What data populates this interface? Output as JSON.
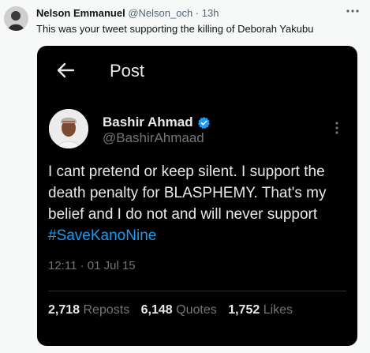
{
  "tweet": {
    "author_name": "Nelson Emmanuel",
    "author_handle": "@Nelson_och",
    "separator": " · ",
    "time_ago": "13h",
    "text": "This was your tweet supporting the killing of Deborah Yakubu"
  },
  "embedded": {
    "title": "Post",
    "display_name": "Bashir Ahmad",
    "handle": "@BashirAhmaad",
    "body_text": "I cant pretend or keep silent. I support the death penalty for BLASPHEMY. That's my belief and I do not and will never support ",
    "hashtag": "#SaveKanoNine",
    "timestamp": "12:11 · 01 Jul 15",
    "stats": {
      "reposts_count": "2,718",
      "reposts_label": "Reposts",
      "quotes_count": "6,148",
      "quotes_label": "Quotes",
      "likes_count": "1,752",
      "likes_label": "Likes"
    }
  },
  "colors": {
    "accent": "#1d9bf0",
    "card_bg": "#000000",
    "page_bg": "#f7f9f9"
  },
  "icons": [
    "more-horizontal-icon",
    "back-arrow-icon",
    "verified-badge-icon",
    "more-vertical-icon"
  ]
}
